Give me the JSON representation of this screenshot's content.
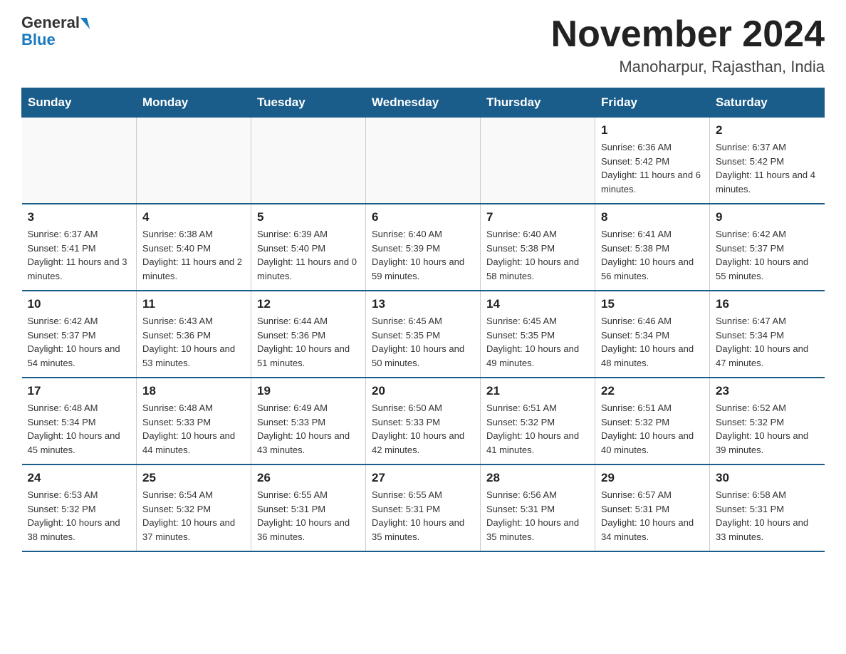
{
  "header": {
    "logo_line1": "General",
    "logo_line2": "Blue",
    "month_title": "November 2024",
    "location": "Manoharpur, Rajasthan, India"
  },
  "weekdays": [
    "Sunday",
    "Monday",
    "Tuesday",
    "Wednesday",
    "Thursday",
    "Friday",
    "Saturday"
  ],
  "weeks": [
    [
      {
        "day": "",
        "info": ""
      },
      {
        "day": "",
        "info": ""
      },
      {
        "day": "",
        "info": ""
      },
      {
        "day": "",
        "info": ""
      },
      {
        "day": "",
        "info": ""
      },
      {
        "day": "1",
        "info": "Sunrise: 6:36 AM\nSunset: 5:42 PM\nDaylight: 11 hours and 6 minutes."
      },
      {
        "day": "2",
        "info": "Sunrise: 6:37 AM\nSunset: 5:42 PM\nDaylight: 11 hours and 4 minutes."
      }
    ],
    [
      {
        "day": "3",
        "info": "Sunrise: 6:37 AM\nSunset: 5:41 PM\nDaylight: 11 hours and 3 minutes."
      },
      {
        "day": "4",
        "info": "Sunrise: 6:38 AM\nSunset: 5:40 PM\nDaylight: 11 hours and 2 minutes."
      },
      {
        "day": "5",
        "info": "Sunrise: 6:39 AM\nSunset: 5:40 PM\nDaylight: 11 hours and 0 minutes."
      },
      {
        "day": "6",
        "info": "Sunrise: 6:40 AM\nSunset: 5:39 PM\nDaylight: 10 hours and 59 minutes."
      },
      {
        "day": "7",
        "info": "Sunrise: 6:40 AM\nSunset: 5:38 PM\nDaylight: 10 hours and 58 minutes."
      },
      {
        "day": "8",
        "info": "Sunrise: 6:41 AM\nSunset: 5:38 PM\nDaylight: 10 hours and 56 minutes."
      },
      {
        "day": "9",
        "info": "Sunrise: 6:42 AM\nSunset: 5:37 PM\nDaylight: 10 hours and 55 minutes."
      }
    ],
    [
      {
        "day": "10",
        "info": "Sunrise: 6:42 AM\nSunset: 5:37 PM\nDaylight: 10 hours and 54 minutes."
      },
      {
        "day": "11",
        "info": "Sunrise: 6:43 AM\nSunset: 5:36 PM\nDaylight: 10 hours and 53 minutes."
      },
      {
        "day": "12",
        "info": "Sunrise: 6:44 AM\nSunset: 5:36 PM\nDaylight: 10 hours and 51 minutes."
      },
      {
        "day": "13",
        "info": "Sunrise: 6:45 AM\nSunset: 5:35 PM\nDaylight: 10 hours and 50 minutes."
      },
      {
        "day": "14",
        "info": "Sunrise: 6:45 AM\nSunset: 5:35 PM\nDaylight: 10 hours and 49 minutes."
      },
      {
        "day": "15",
        "info": "Sunrise: 6:46 AM\nSunset: 5:34 PM\nDaylight: 10 hours and 48 minutes."
      },
      {
        "day": "16",
        "info": "Sunrise: 6:47 AM\nSunset: 5:34 PM\nDaylight: 10 hours and 47 minutes."
      }
    ],
    [
      {
        "day": "17",
        "info": "Sunrise: 6:48 AM\nSunset: 5:34 PM\nDaylight: 10 hours and 45 minutes."
      },
      {
        "day": "18",
        "info": "Sunrise: 6:48 AM\nSunset: 5:33 PM\nDaylight: 10 hours and 44 minutes."
      },
      {
        "day": "19",
        "info": "Sunrise: 6:49 AM\nSunset: 5:33 PM\nDaylight: 10 hours and 43 minutes."
      },
      {
        "day": "20",
        "info": "Sunrise: 6:50 AM\nSunset: 5:33 PM\nDaylight: 10 hours and 42 minutes."
      },
      {
        "day": "21",
        "info": "Sunrise: 6:51 AM\nSunset: 5:32 PM\nDaylight: 10 hours and 41 minutes."
      },
      {
        "day": "22",
        "info": "Sunrise: 6:51 AM\nSunset: 5:32 PM\nDaylight: 10 hours and 40 minutes."
      },
      {
        "day": "23",
        "info": "Sunrise: 6:52 AM\nSunset: 5:32 PM\nDaylight: 10 hours and 39 minutes."
      }
    ],
    [
      {
        "day": "24",
        "info": "Sunrise: 6:53 AM\nSunset: 5:32 PM\nDaylight: 10 hours and 38 minutes."
      },
      {
        "day": "25",
        "info": "Sunrise: 6:54 AM\nSunset: 5:32 PM\nDaylight: 10 hours and 37 minutes."
      },
      {
        "day": "26",
        "info": "Sunrise: 6:55 AM\nSunset: 5:31 PM\nDaylight: 10 hours and 36 minutes."
      },
      {
        "day": "27",
        "info": "Sunrise: 6:55 AM\nSunset: 5:31 PM\nDaylight: 10 hours and 35 minutes."
      },
      {
        "day": "28",
        "info": "Sunrise: 6:56 AM\nSunset: 5:31 PM\nDaylight: 10 hours and 35 minutes."
      },
      {
        "day": "29",
        "info": "Sunrise: 6:57 AM\nSunset: 5:31 PM\nDaylight: 10 hours and 34 minutes."
      },
      {
        "day": "30",
        "info": "Sunrise: 6:58 AM\nSunset: 5:31 PM\nDaylight: 10 hours and 33 minutes."
      }
    ]
  ]
}
